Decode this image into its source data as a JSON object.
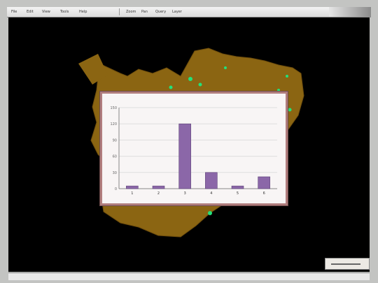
{
  "toolbar": {
    "items": [
      "File",
      "Edit",
      "View",
      "Tools",
      "Help"
    ],
    "extras": [
      "Zoom",
      "Pan",
      "Query",
      "Layer"
    ]
  },
  "map": {
    "region_color": "#8b6512",
    "point_color": "#23e07a",
    "background": "#000000"
  },
  "popup": {
    "title": "",
    "subtitle": ""
  },
  "chart_data": {
    "type": "bar",
    "categories": [
      "1",
      "2",
      "3",
      "4",
      "5",
      "6"
    ],
    "values": [
      5,
      5,
      120,
      30,
      5,
      22
    ],
    "ylim": [
      0,
      150
    ],
    "yticks": [
      0,
      30,
      60,
      90,
      120,
      150
    ],
    "bar_color": "#8b67a8",
    "title": "",
    "xlabel": "",
    "ylabel": ""
  },
  "scale": {
    "label": ""
  }
}
